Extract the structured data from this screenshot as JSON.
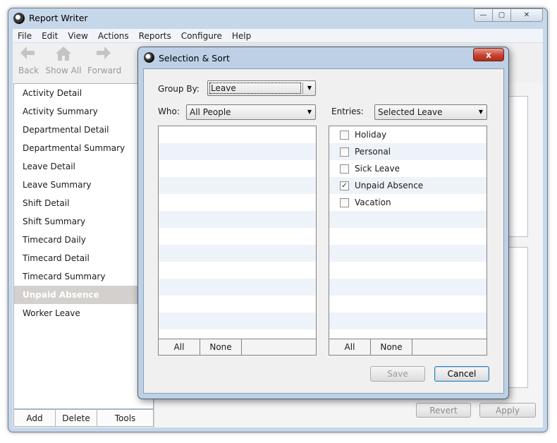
{
  "window": {
    "title": "Report Writer",
    "caption": {
      "minimize": "—",
      "maximize": "▢",
      "close": "✕"
    }
  },
  "menu": [
    "File",
    "Edit",
    "View",
    "Actions",
    "Reports",
    "Configure",
    "Help"
  ],
  "toolbar": {
    "back": {
      "label": "Back",
      "icon": "arrow-left-icon"
    },
    "show_all": {
      "label": "Show All",
      "icon": "home-icon"
    },
    "forward": {
      "label": "Forward",
      "icon": "arrow-right-icon"
    }
  },
  "reports": [
    "Activity Detail",
    "Activity Summary",
    "Departmental Detail",
    "Departmental Summary",
    "Leave Detail",
    "Leave Summary",
    "Shift Detail",
    "Shift Summary",
    "Timecard Daily",
    "Timecard Detail",
    "Timecard Summary",
    "Unpaid Absence",
    "Worker Leave"
  ],
  "selected_report": "Unpaid Absence",
  "left_buttons": {
    "add": "Add",
    "delete": "Delete",
    "tools": "Tools"
  },
  "main_buttons": {
    "revert": "Revert",
    "apply": "Apply"
  },
  "dialog": {
    "title": "Selection & Sort",
    "close": "x",
    "group_by": {
      "label": "Group By:",
      "value": "Leave"
    },
    "who": {
      "label": "Who:",
      "value": "All People"
    },
    "entries": {
      "label": "Entries:",
      "value": "Selected Leave"
    },
    "entry_items": [
      {
        "label": "Holiday",
        "checked": false
      },
      {
        "label": "Personal",
        "checked": false
      },
      {
        "label": "Sick Leave",
        "checked": false
      },
      {
        "label": "Unpaid Absence",
        "checked": true
      },
      {
        "label": "Vacation",
        "checked": false
      }
    ],
    "who_footer": {
      "all": "All",
      "none": "None"
    },
    "entries_footer": {
      "all": "All",
      "none": "None"
    },
    "save": "Save",
    "cancel": "Cancel",
    "check_mark": "✓"
  }
}
